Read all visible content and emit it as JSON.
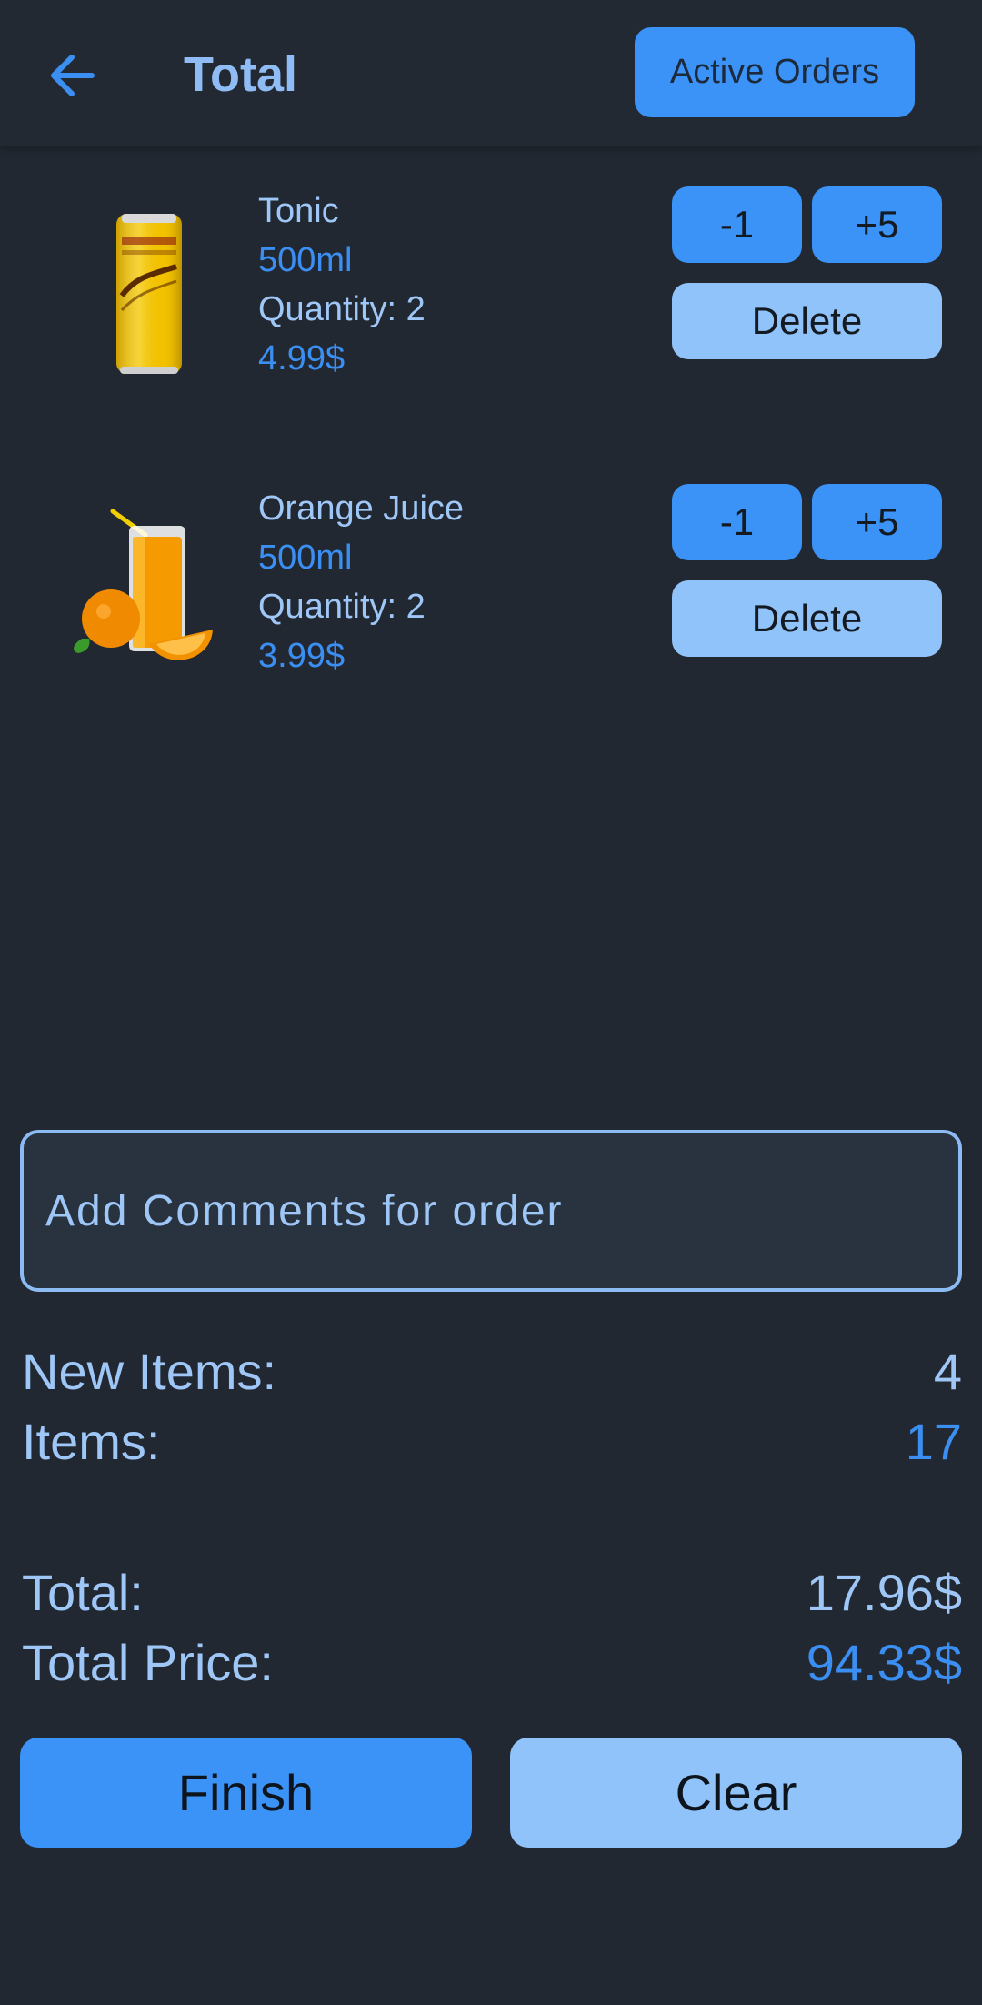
{
  "header": {
    "title": "Total",
    "active_orders_label": "Active Orders",
    "back_icon": "arrow-left-icon"
  },
  "items": [
    {
      "name": "Tonic",
      "size": "500ml",
      "quantity": "Quantity: 2",
      "price": "4.99$",
      "image_icon": "tonic-can-image",
      "minus_label": "-1",
      "plus_label": "+5",
      "delete_label": "Delete"
    },
    {
      "name": "Orange Juice",
      "size": "500ml",
      "quantity": "Quantity: 2",
      "price": "3.99$",
      "image_icon": "orange-juice-image",
      "minus_label": "-1",
      "plus_label": "+5",
      "delete_label": "Delete"
    }
  ],
  "comments": {
    "placeholder": "Add Comments for order",
    "value": ""
  },
  "summary": {
    "new_items_label": "New Items:",
    "new_items_value": "4",
    "items_label": "Items:",
    "items_value": "17",
    "total_label": "Total:",
    "total_value": "17.96$",
    "total_price_label": "Total Price:",
    "total_price_value": "94.33$"
  },
  "actions": {
    "finish_label": "Finish",
    "clear_label": "Clear"
  },
  "colors": {
    "background": "#222831",
    "primary": "#3b93f8",
    "secondary": "#91c3fb",
    "text_light": "#9ec7f7",
    "text_blue": "#3b8ff3"
  }
}
